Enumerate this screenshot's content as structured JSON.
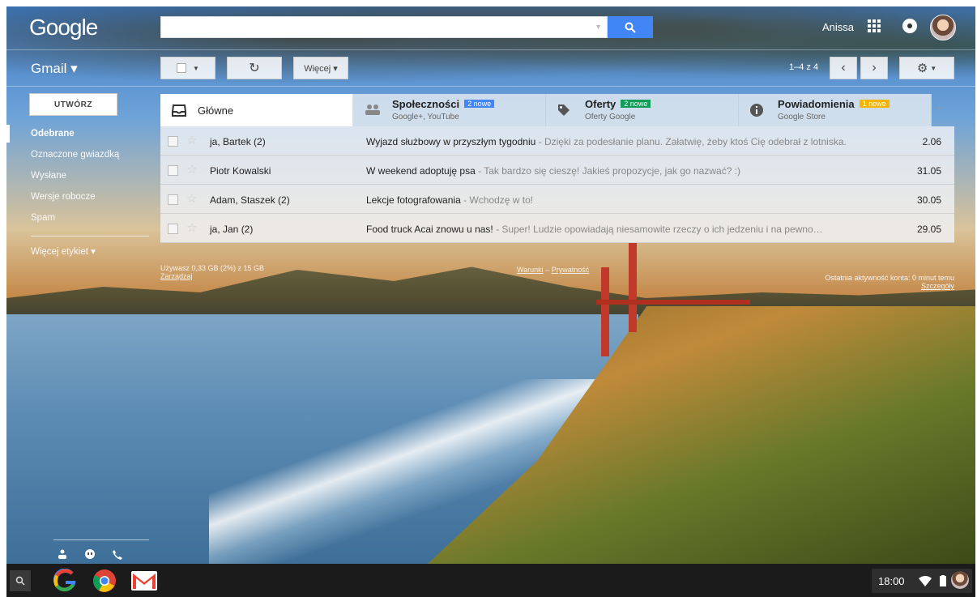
{
  "header": {
    "logo": "Google",
    "search_value": "",
    "user_name": "Anissa"
  },
  "toolbar": {
    "app_label": "Gmail ▾",
    "more_label": "Więcej ▾",
    "range": "1–4 z 4"
  },
  "sidebar": {
    "compose": "UTWÓRZ",
    "items": [
      {
        "label": "Odebrane"
      },
      {
        "label": "Oznaczone gwiazdką"
      },
      {
        "label": "Wysłane"
      },
      {
        "label": "Wersje robocze"
      },
      {
        "label": "Spam"
      },
      {
        "label": "Więcej etykiet ▾"
      }
    ]
  },
  "tabs": [
    {
      "title": "Główne"
    },
    {
      "title": "Społeczności",
      "badge": "2 nowe",
      "sub": "Google+, YouTube",
      "badge_color": "#4285f4"
    },
    {
      "title": "Oferty",
      "badge": "2 nowe",
      "sub": "Oferty Google",
      "badge_color": "#0f9d58"
    },
    {
      "title": "Powiadomienia",
      "badge": "1 nowe",
      "sub": "Google Store",
      "badge_color": "#f4b400"
    }
  ],
  "emails": [
    {
      "from": "ja, Bartek (2)",
      "subject": "Wyjazd służbowy w przyszłym tygodniu",
      "snippet": " - Dzięki za podesłanie planu. Załatwię, żeby ktoś Cię odebrał z lotniska.",
      "date": "2.06"
    },
    {
      "from": "Piotr Kowalski",
      "subject": "W weekend adoptuję psa",
      "snippet": " - Tak bardzo się cieszę! Jakieś propozycje, jak go nazwać? :)",
      "date": "31.05"
    },
    {
      "from": "Adam, Staszek (2)",
      "subject": "Lekcje fotografowania",
      "snippet": " - Wchodzę w to!",
      "date": "30.05"
    },
    {
      "from": "ja, Jan (2)",
      "subject": "Food truck Acai znowu u nas!",
      "snippet": " - Super! Ludzie opowiadają niesamowite rzeczy o ich jedzeniu i na pewno…",
      "date": "29.05"
    }
  ],
  "footer": {
    "storage": "Używasz 0,33 GB (2%) z 15 GB",
    "manage": "Zarządzaj",
    "terms": "Warunki",
    "privacy": "Prywatność",
    "activity": "Ostatnia aktywność konta: 0 minut temu",
    "details": "Szczegóły"
  },
  "taskbar": {
    "time": "18:00"
  },
  "colors": {
    "search_button": "#4285f4",
    "gmail_red": "#ea4335"
  }
}
